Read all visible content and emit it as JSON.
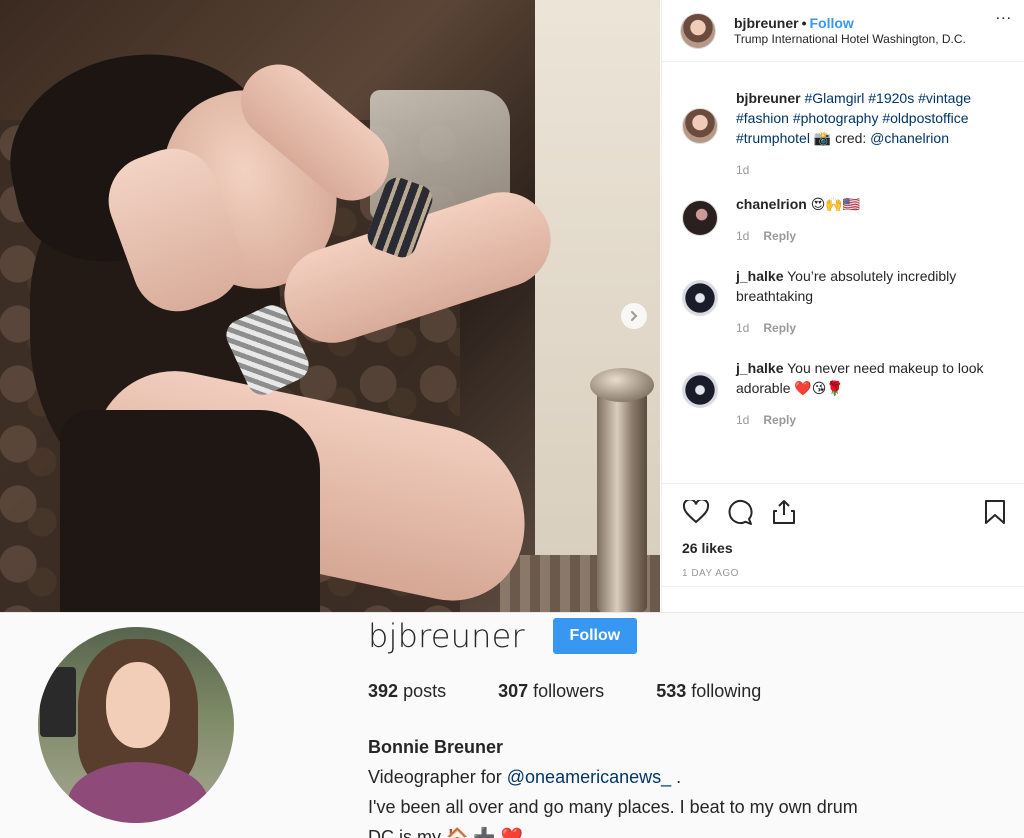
{
  "post": {
    "next_icon": "chevron-right-icon"
  },
  "header": {
    "username": "bjbreuner",
    "separator": "•",
    "follow_label": "Follow",
    "location": "Trump International Hotel Washington, D.C.",
    "more_icon": "more-dots-icon",
    "more_label": "..."
  },
  "caption": {
    "username": "bjbreuner",
    "text_before": " ",
    "hashtags": "#Glamgirl #1920s #vintage #fashion #photography #oldpostoffice #trumphotel",
    "camera_emoji": "📸",
    "cred_text": " cred: ",
    "mention": "@chanelrion",
    "time": "1d"
  },
  "comments": [
    {
      "username": "chanelrion",
      "text": "😍🙌🇺🇸",
      "time": "1d",
      "reply": "Reply"
    },
    {
      "username": "j_halke",
      "text": "You’re absolutely incredibly breathtaking",
      "time": "1d",
      "reply": "Reply"
    },
    {
      "username": "j_halke",
      "text": "You never need makeup to look adorable ❤️😘🌹",
      "time": "1d",
      "reply": "Reply"
    }
  ],
  "actions": {
    "icons": [
      "heart-icon",
      "comment-icon",
      "share-icon",
      "bookmark-icon"
    ],
    "likes": "26 likes",
    "time_ago": "1 DAY AGO"
  },
  "profile": {
    "username": "bjbreuner",
    "follow_label": "Follow",
    "posts_count": "392",
    "posts_label": "posts",
    "followers_count": "307",
    "followers_label": "followers",
    "following_count": "533",
    "following_label": "following",
    "full_name": "Bonnie Breuner",
    "bio_line1_prefix": "Videographer for ",
    "bio_line1_link": "@oneamericanews_",
    "bio_line1_suffix": " .",
    "bio_line2": "I've been all over and go many places. I beat to my own drum",
    "bio_line3": "DC is my 🏠 ➕ ❤️"
  },
  "colors": {
    "accent": "#3897f0",
    "link": "#003569",
    "muted": "#999999"
  }
}
